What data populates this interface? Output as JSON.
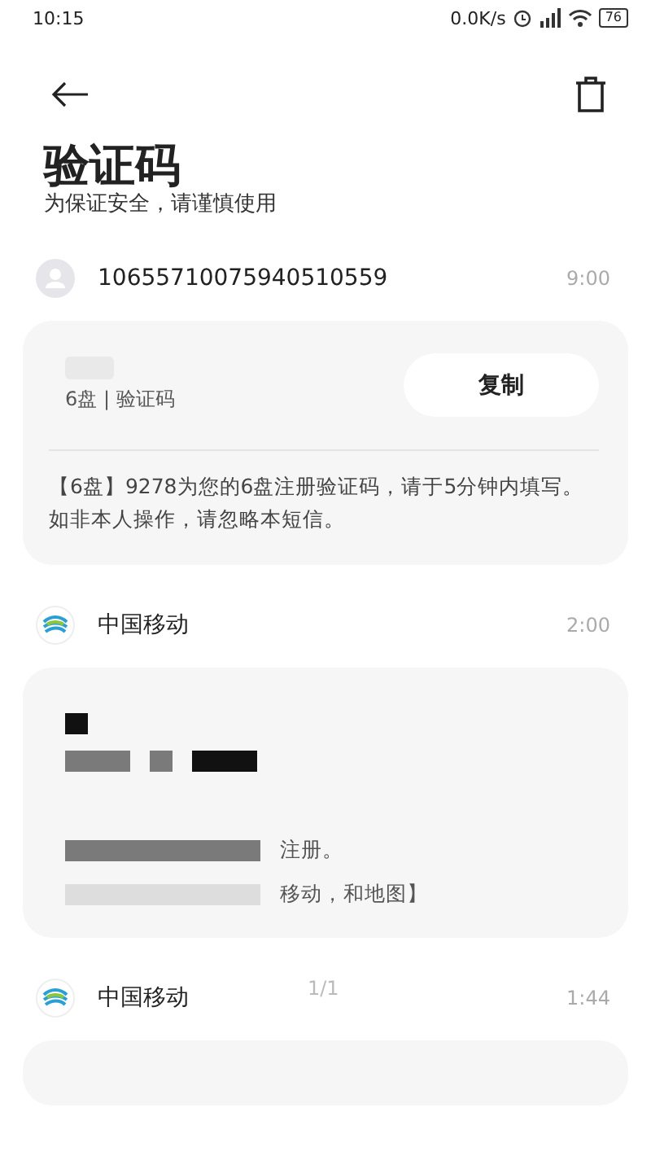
{
  "status_bar": {
    "time": "10:15",
    "speed": "0.0K/s",
    "battery": "76"
  },
  "header": {
    "title": "验证码",
    "subtitle": "为保证安全，请谨慎使用"
  },
  "messages": [
    {
      "sender": {
        "kind": "person",
        "name": "10655710075940510559"
      },
      "time": "9:00",
      "kind": "code",
      "source": "6盘 | 验证码",
      "copy": "复制",
      "body": "【6盘】9278为您的6盘注册验证码，请于5分钟内填写。如非本人操作，请忽略本短信。"
    },
    {
      "sender": {
        "kind": "carrier",
        "name": "中国移动"
      },
      "time": "2:00",
      "kind": "redacted",
      "fragments": [
        "注册。",
        "移动，和地图】"
      ]
    },
    {
      "sender": {
        "kind": "carrier",
        "name": "中国移动"
      },
      "time": "1:44",
      "kind": "empty"
    }
  ],
  "page_indicator": "1/1"
}
